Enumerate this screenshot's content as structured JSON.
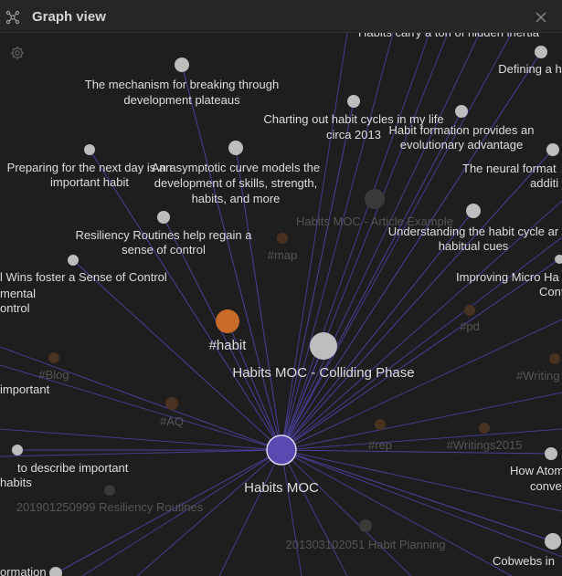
{
  "window": {
    "title": "Graph view"
  },
  "icons": {
    "graph": "graph-icon",
    "close": "close-icon",
    "settings": "gear-icon"
  },
  "colors": {
    "background": "#1e1e1e",
    "edge": "#4a3f9c",
    "focus_node": "#5b48b0",
    "tag_node": "#c86b28",
    "node": "#bdbdbd",
    "faded_node": "#3a3a3a",
    "label": "#dedede",
    "faded_label": "#555555"
  },
  "graph": {
    "center_node": {
      "label": "Habits MOC"
    },
    "nodes": [
      {
        "label": "Habits carry a ton of hidden inertia",
        "kind": "node"
      },
      {
        "label": "Defining a h",
        "kind": "node"
      },
      {
        "label": "The mechanism for breaking through development plateaus",
        "kind": "node"
      },
      {
        "label": "Charting out habit cycles in my life circa 2013",
        "kind": "node"
      },
      {
        "label": "Habit formation provides an evolutionary advantage",
        "kind": "node"
      },
      {
        "label": "Preparing for the next day is an important habit",
        "kind": "node"
      },
      {
        "label": "An asymptotic curve models the development of skills, strength, habits, and more",
        "kind": "node"
      },
      {
        "label": "The neural format additi",
        "kind": "node"
      },
      {
        "label": "Habits MOC - Article Example",
        "kind": "faded"
      },
      {
        "label": "Understanding the habit cycle ar habitual cues",
        "kind": "node"
      },
      {
        "label": "Resiliency Routines help regain a sense of control",
        "kind": "node"
      },
      {
        "label": "#map",
        "kind": "faded-tag"
      },
      {
        "label": "Improving Micro Ha Cont",
        "kind": "node"
      },
      {
        "label": "l Wins foster a Sense of Control mental ontrol",
        "kind": "node"
      },
      {
        "label": "#pd",
        "kind": "faded-tag"
      },
      {
        "label": "#habit",
        "kind": "tag"
      },
      {
        "label": "Habits MOC - Colliding Phase",
        "kind": "node"
      },
      {
        "label": "#Blog",
        "kind": "faded-tag"
      },
      {
        "label": "#Writing",
        "kind": "faded-tag"
      },
      {
        "label": "important",
        "kind": "node"
      },
      {
        "label": "#AQ",
        "kind": "faded-tag"
      },
      {
        "label": "#rep",
        "kind": "faded-tag"
      },
      {
        "label": "#Writings2015",
        "kind": "faded-tag"
      },
      {
        "label": "to describe important habits",
        "kind": "node"
      },
      {
        "label": "How Atom conve",
        "kind": "node"
      },
      {
        "label": "201901250999 Resiliency Routines",
        "kind": "faded"
      },
      {
        "label": "201303102051 Habit Planning",
        "kind": "faded"
      },
      {
        "label": "Cobwebs in",
        "kind": "node"
      },
      {
        "label": "ormation",
        "kind": "node"
      }
    ]
  }
}
